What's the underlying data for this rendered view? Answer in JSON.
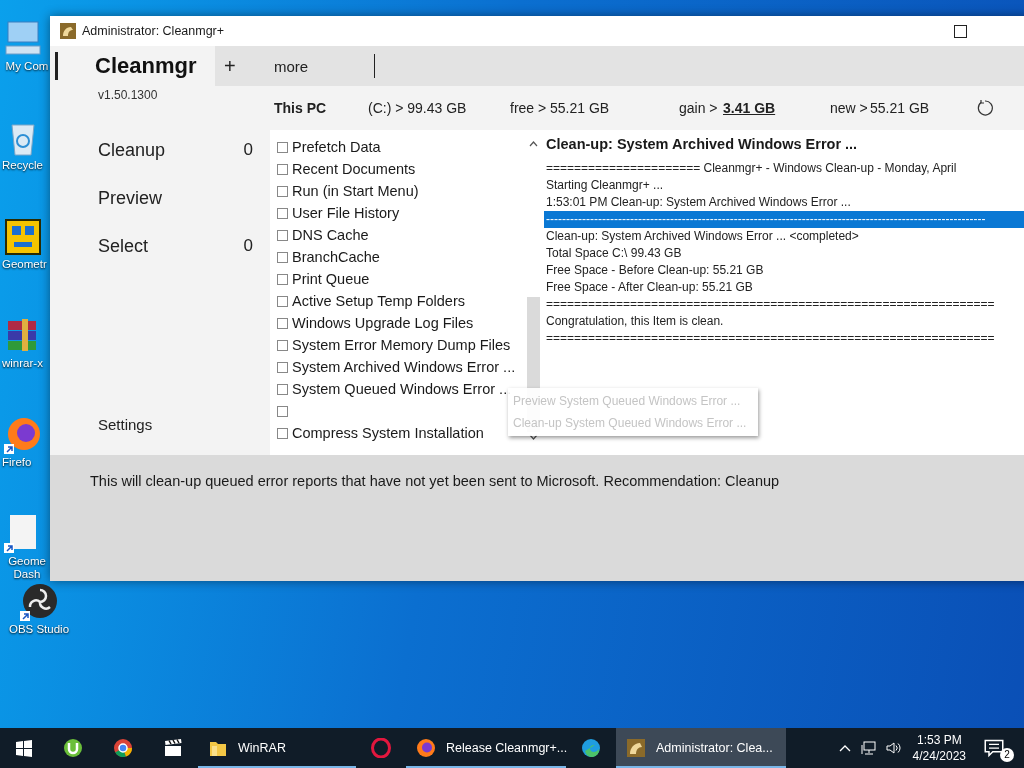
{
  "desktop_icons": [
    {
      "kind": "computer",
      "label": "My Com"
    },
    {
      "kind": "recycle",
      "label": "Recycle"
    },
    {
      "kind": "game",
      "label": "Geometr"
    },
    {
      "kind": "archive",
      "label": "winrar-x"
    },
    {
      "kind": "browser",
      "label": "Firefo"
    },
    {
      "kind": "file",
      "label": "Geome Dash"
    },
    {
      "kind": "obs",
      "label": "OBS Studio"
    }
  ],
  "window": {
    "title": "Administrator: Cleanmgr+"
  },
  "header": {
    "app_name": "Cleanmgr",
    "version": "v1.50.1300"
  },
  "toolbar": {
    "add": "+",
    "more": "more"
  },
  "sidebar": {
    "items": [
      {
        "label": "Cleanup",
        "count": "0"
      },
      {
        "label": "Preview"
      },
      {
        "label": "Select",
        "count": "0"
      }
    ],
    "settings": "Settings"
  },
  "drive_info": {
    "name": "This PC",
    "drive": "(C:) > 99.43 GB",
    "free_label": "free >",
    "free": "55.21 GB",
    "gain_label": "gain >",
    "gain": "3.41 GB",
    "new_label": "new >",
    "new": "55.21 GB"
  },
  "checklist": [
    {
      "label": "Prefetch Data",
      "checked": false
    },
    {
      "label": "Recent Documents",
      "checked": false
    },
    {
      "label": "Run (in Start Menu)",
      "checked": false
    },
    {
      "label": "User File History",
      "checked": false
    },
    {
      "label": "DNS Cache",
      "checked": false
    },
    {
      "label": "BranchCache",
      "checked": false
    },
    {
      "label": "Print Queue",
      "checked": false
    },
    {
      "label": "Active Setup Temp Folders",
      "checked": false
    },
    {
      "label": "Windows Upgrade Log Files",
      "checked": false
    },
    {
      "label": "System Error Memory Dump Files",
      "checked": false
    },
    {
      "label": "System Archived Windows Error ...",
      "checked": false
    },
    {
      "label": "System Queued Windows Error ...",
      "checked": false
    },
    {
      "checked": false
    },
    {
      "label": "Compress System Installation",
      "checked": false
    }
  ],
  "log": {
    "title": "Clean-up: System Archived Windows Error ...",
    "lines": [
      {
        "text": "====================== Cleanmgr+ - Windows Clean-up - Monday, April",
        "selected": false
      },
      {
        "text": "Starting Cleanmgr+ ...",
        "selected": false
      },
      {
        "text": "1:53:01 PM Clean-up: System Archived Windows Error ...",
        "selected": false
      },
      {
        "text": "--------------------------------------------------------------------------------------------------------------",
        "selected": true
      },
      {
        "text": "Clean-up: System Archived Windows Error ... <completed>",
        "selected": false
      },
      {
        "text": "Total Space C:\\ 99.43 GB",
        "selected": false
      },
      {
        "text": "Free Space - Before Clean-up: 55.21 GB",
        "selected": false
      },
      {
        "text": "Free Space - After Clean-up: 55.21 GB",
        "selected": false
      },
      {
        "text": "================================================================",
        "selected": false
      },
      {
        "text": "Congratulation, this Item is clean.",
        "selected": false
      },
      {
        "text": "================================================================",
        "selected": false
      }
    ]
  },
  "description": "This will clean-up queued error reports that have not yet been sent to Microsoft. Recommendation: Cleanup",
  "context_menu": [
    {
      "label": "Preview System Queued Windows Error ..."
    },
    {
      "label": "Clean-up System Queued Windows Error ..."
    }
  ],
  "taskbar": {
    "items": [
      {
        "kind": "start",
        "running": false,
        "active": false
      },
      {
        "kind": "torrent",
        "running": false,
        "active": false
      },
      {
        "kind": "chrome",
        "running": false,
        "active": false
      },
      {
        "kind": "clapper",
        "running": false,
        "active": false
      },
      {
        "kind": "folder",
        "label": "WinRAR",
        "running": true,
        "active": false
      },
      {
        "kind": "opera",
        "running": false,
        "active": false
      },
      {
        "kind": "firefox",
        "label": "Release Cleanmgr+...",
        "running": true,
        "active": false
      },
      {
        "kind": "edge",
        "running": false,
        "active": false
      },
      {
        "kind": "app",
        "label": "Administrator: Clea...",
        "running": true,
        "active": true
      }
    ],
    "time": "1:53 PM",
    "date": "4/24/2023",
    "notifications": "2"
  }
}
